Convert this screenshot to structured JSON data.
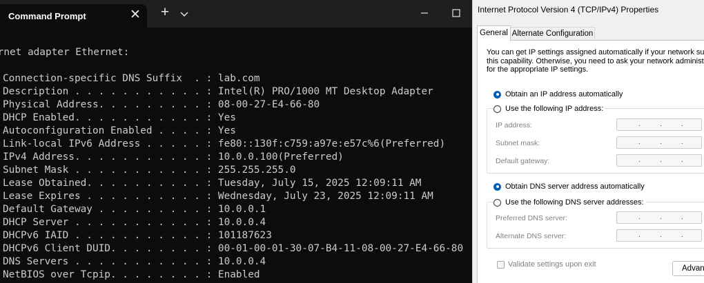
{
  "cmd": {
    "tab_title": "Command Prompt",
    "tab_close": "✕",
    "new_tab": "+",
    "lines": [
      "ernet adapter Ethernet:",
      "",
      "Connection-specific DNS Suffix  . : lab.com",
      "Description . . . . . . . . . . . : Intel(R) PRO/1000 MT Desktop Adapter",
      "Physical Address. . . . . . . . . : 08-00-27-E4-66-80",
      "DHCP Enabled. . . . . . . . . . . : Yes",
      "Autoconfiguration Enabled . . . . : Yes",
      "Link-local IPv6 Address . . . . . : fe80::130f:c759:a97e:e57c%6(Preferred)",
      "IPv4 Address. . . . . . . . . . . : 10.0.0.100(Preferred)",
      "Subnet Mask . . . . . . . . . . . : 255.255.255.0",
      "Lease Obtained. . . . . . . . . . : Tuesday, July 15, 2025 12:09:11 AM",
      "Lease Expires . . . . . . . . . . : Wednesday, July 23, 2025 12:09:11 AM",
      "Default Gateway . . . . . . . . . : 10.0.0.1",
      "DHCP Server . . . . . . . . . . . : 10.0.0.4",
      "DHCPv6 IAID . . . . . . . . . . . : 101187623",
      "DHCPv6 Client DUID. . . . . . . . : 00-01-00-01-30-07-B4-11-08-00-27-E4-66-80",
      "DNS Servers . . . . . . . . . . . : 10.0.0.4",
      "NetBIOS over Tcpip. . . . . . . . : Enabled"
    ]
  },
  "dialog": {
    "title": "Internet Protocol Version 4 (TCP/IPv4) Properties",
    "tabs": [
      "General",
      "Alternate Configuration"
    ],
    "intro_lines": [
      "You can get IP settings assigned automatically if your network supports",
      "this capability. Otherwise, you need to ask your network administrator",
      "for the appropriate IP settings."
    ],
    "ip_auto": "Obtain an IP address automatically",
    "ip_manual": "Use the following IP address:",
    "ip_fields": [
      "IP address:",
      "Subnet mask:",
      "Default gateway:"
    ],
    "dns_auto": "Obtain DNS server address automatically",
    "dns_manual": "Use the following DNS server addresses:",
    "dns_fields": [
      "Preferred DNS server:",
      "Alternate DNS server:"
    ],
    "dot": ".",
    "validate": "Validate settings upon exit",
    "advanced": "Advanced..."
  }
}
